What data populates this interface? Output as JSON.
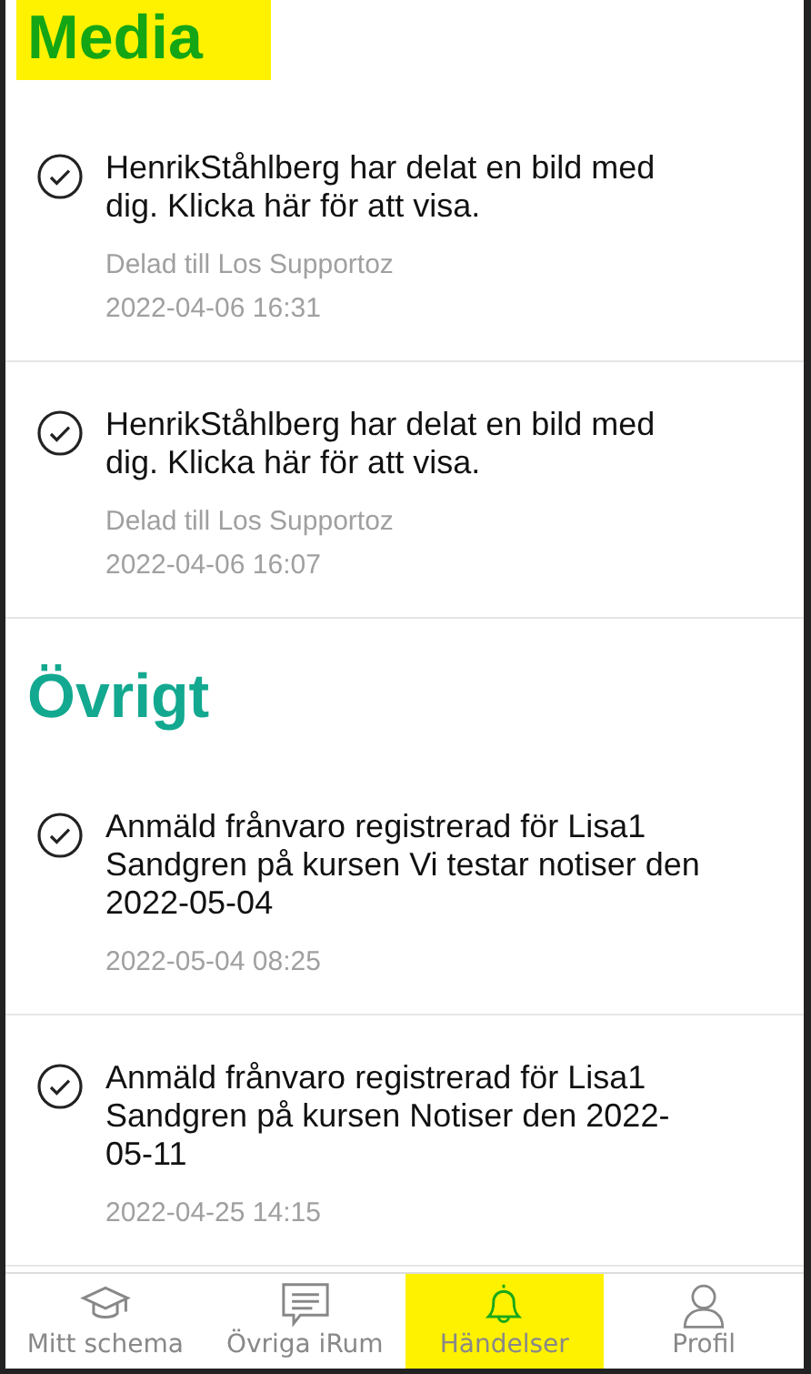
{
  "sections": [
    {
      "title": "Media",
      "highlighted": true,
      "items": [
        {
          "text": "HenrikStåhlberg har delat en bild med dig. Klicka här för att visa.",
          "detail": "Delad till Los Supportoz",
          "time": "2022-04-06 16:31"
        },
        {
          "text": "HenrikStåhlberg har delat en bild med dig. Klicka här för att visa.",
          "detail": "Delad till Los Supportoz",
          "time": "2022-04-06 16:07"
        }
      ]
    },
    {
      "title": "Övrigt",
      "highlighted": false,
      "items": [
        {
          "text": "Anmäld frånvaro registrerad för Lisa1 Sandgren på kursen Vi testar notiser den 2022-05-04",
          "time": "2022-05-04 08:25"
        },
        {
          "text": "Anmäld frånvaro registrerad för Lisa1 Sandgren på kursen Notiser den 2022-05-11",
          "time": "2022-04-25 14:15"
        }
      ]
    }
  ],
  "tabs": [
    {
      "label": "Mitt schema",
      "kind": "cap",
      "selected": false,
      "highlighted": false
    },
    {
      "label": "Övriga iRum",
      "kind": "chat",
      "selected": false,
      "highlighted": false
    },
    {
      "label": "Händelser",
      "kind": "bell",
      "selected": true,
      "highlighted": true
    },
    {
      "label": "Profil",
      "kind": "person",
      "selected": false,
      "highlighted": false
    }
  ]
}
